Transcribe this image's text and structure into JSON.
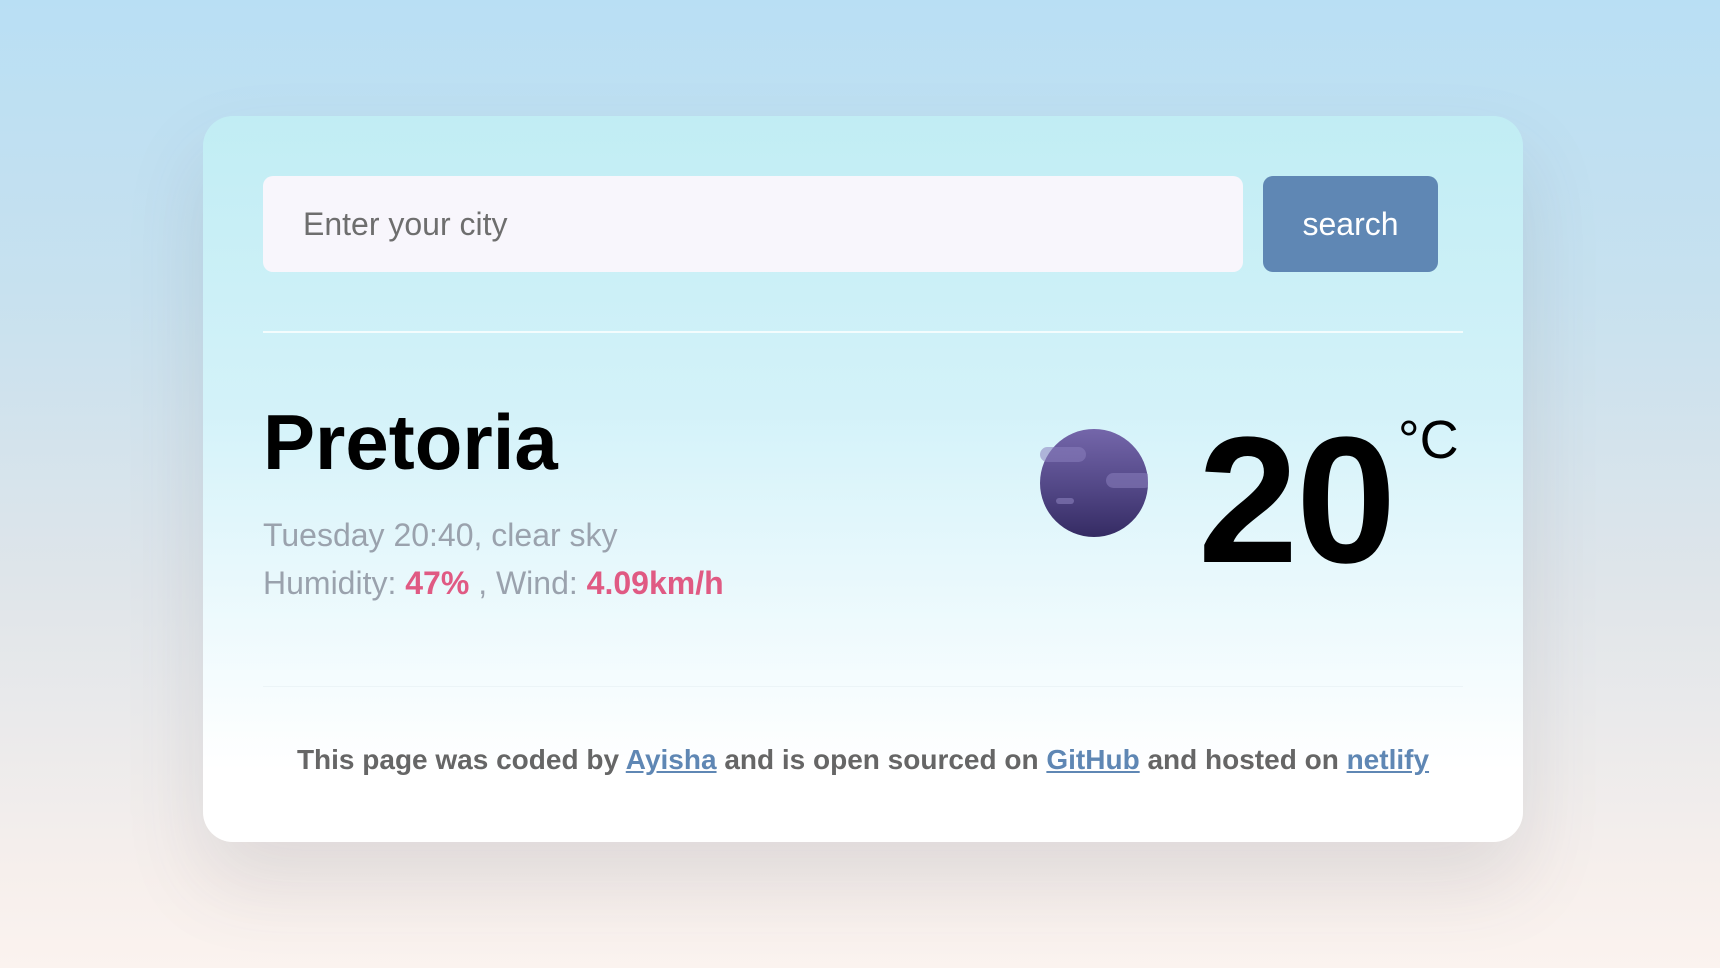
{
  "search": {
    "placeholder": "Enter your city",
    "value": "",
    "button_label": "search"
  },
  "weather": {
    "city": "Pretoria",
    "datetime_desc": "Tuesday 20:40, clear sky",
    "humidity_label": "Humidity: ",
    "humidity_value": "47%",
    "wind_label": " , Wind: ",
    "wind_value": "4.09km/h",
    "icon": "night-clear-moon-icon",
    "temperature": "20",
    "unit": "°C"
  },
  "footer": {
    "text_1": "This page was coded by ",
    "author_link": "Ayisha",
    "text_2": " and is open sourced on ",
    "github_link": "GitHub",
    "text_3": " and hosted on ",
    "netlify_link": "netlify"
  },
  "colors": {
    "accent_button": "#5f87b4",
    "highlight_value": "#e05a83",
    "muted_text": "#9aa2ad",
    "link": "#5f87b4"
  }
}
